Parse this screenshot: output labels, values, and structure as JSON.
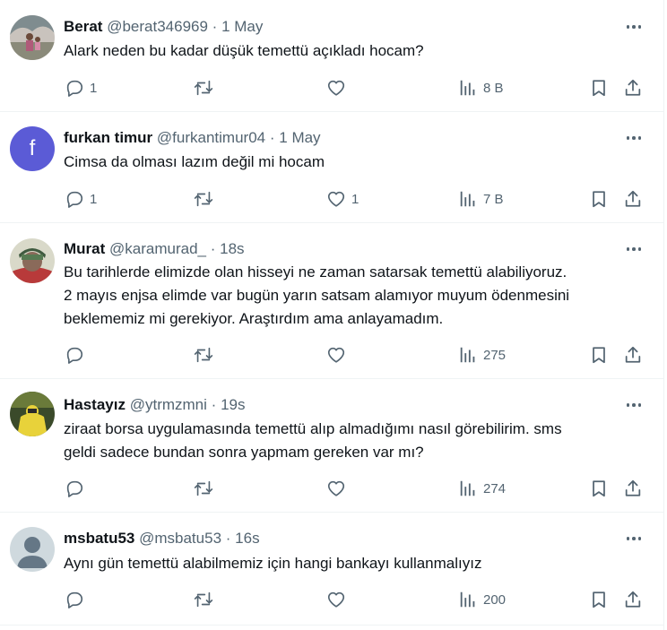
{
  "tweets": [
    {
      "name": "Berat",
      "handle": "@berat346969",
      "dot": "·",
      "time": "1 May",
      "lines": [
        "Alark neden bu kadar düşük temettü açıkladı  hocam?"
      ],
      "reply_count": "1",
      "retweet_count": "",
      "like_count": "",
      "views": "8 B",
      "avatar": "photo"
    },
    {
      "name": "furkan timur",
      "handle": "@furkantimur04",
      "dot": "·",
      "time": "1 May",
      "lines": [
        "Cimsa da olması lazım değil mi hocam"
      ],
      "reply_count": "1",
      "retweet_count": "",
      "like_count": "1",
      "views": "7 B",
      "avatar": "letter",
      "avatar_letter": "f"
    },
    {
      "name": "Murat",
      "handle": "@karamurad_",
      "dot": "·",
      "time": "18s",
      "lines": [
        "Bu tarihlerde elimizde olan hisseyi ne zaman satarsak temettü alabiliyoruz.",
        "2 mayıs enjsa elimde var bugün yarın satsam alamıyor muyum ödenmesini",
        "beklememiz mi gerekiyor. Araştırdım ama anlayamadım."
      ],
      "reply_count": "",
      "retweet_count": "",
      "like_count": "",
      "views": "275",
      "avatar": "photo"
    },
    {
      "name": "Hastayız",
      "handle": "@ytrmzmni",
      "dot": "·",
      "time": "19s",
      "lines": [
        "ziraat borsa uygulamasında temettü alıp almadığımı nasıl görebilirim. sms",
        "geldi sadece bundan sonra yapmam gereken var mı?"
      ],
      "reply_count": "",
      "retweet_count": "",
      "like_count": "",
      "views": "274",
      "avatar": "photo"
    },
    {
      "name": "msbatu53",
      "handle": "@msbatu53",
      "dot": "·",
      "time": "16s",
      "lines": [
        "Aynı gün temettü alabilmemiz için hangi bankayı kullanmalıyız"
      ],
      "reply_count": "",
      "retweet_count": "",
      "like_count": "",
      "views": "200",
      "avatar": "default"
    }
  ],
  "colors": {
    "text": "#0f1419",
    "secondary": "#536471",
    "divider": "#eff3f4",
    "letter_avatar": "#5b5bd6"
  },
  "icons": [
    "reply-icon",
    "retweet-icon",
    "like-icon",
    "views-icon",
    "bookmark-icon",
    "share-icon",
    "more-icon"
  ]
}
